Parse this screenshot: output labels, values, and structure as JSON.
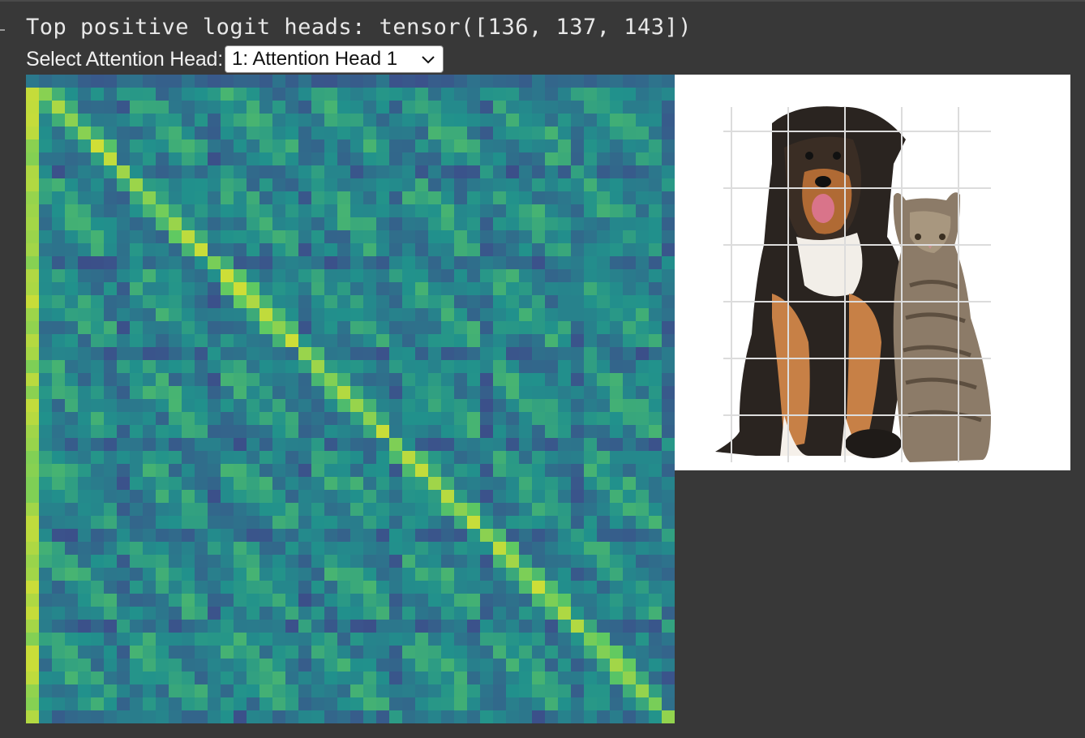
{
  "output": {
    "top_heads_text": "Top positive logit heads: tensor([136, 137, 143])"
  },
  "head_selector": {
    "label": "Select Attention Head:",
    "selected": "1: Attention Head 1",
    "icon": "chevron-down-icon"
  },
  "heatmap": {
    "grid_size": 50,
    "colormap": "viridis",
    "image_icon": "dog-and-cat-photo"
  }
}
